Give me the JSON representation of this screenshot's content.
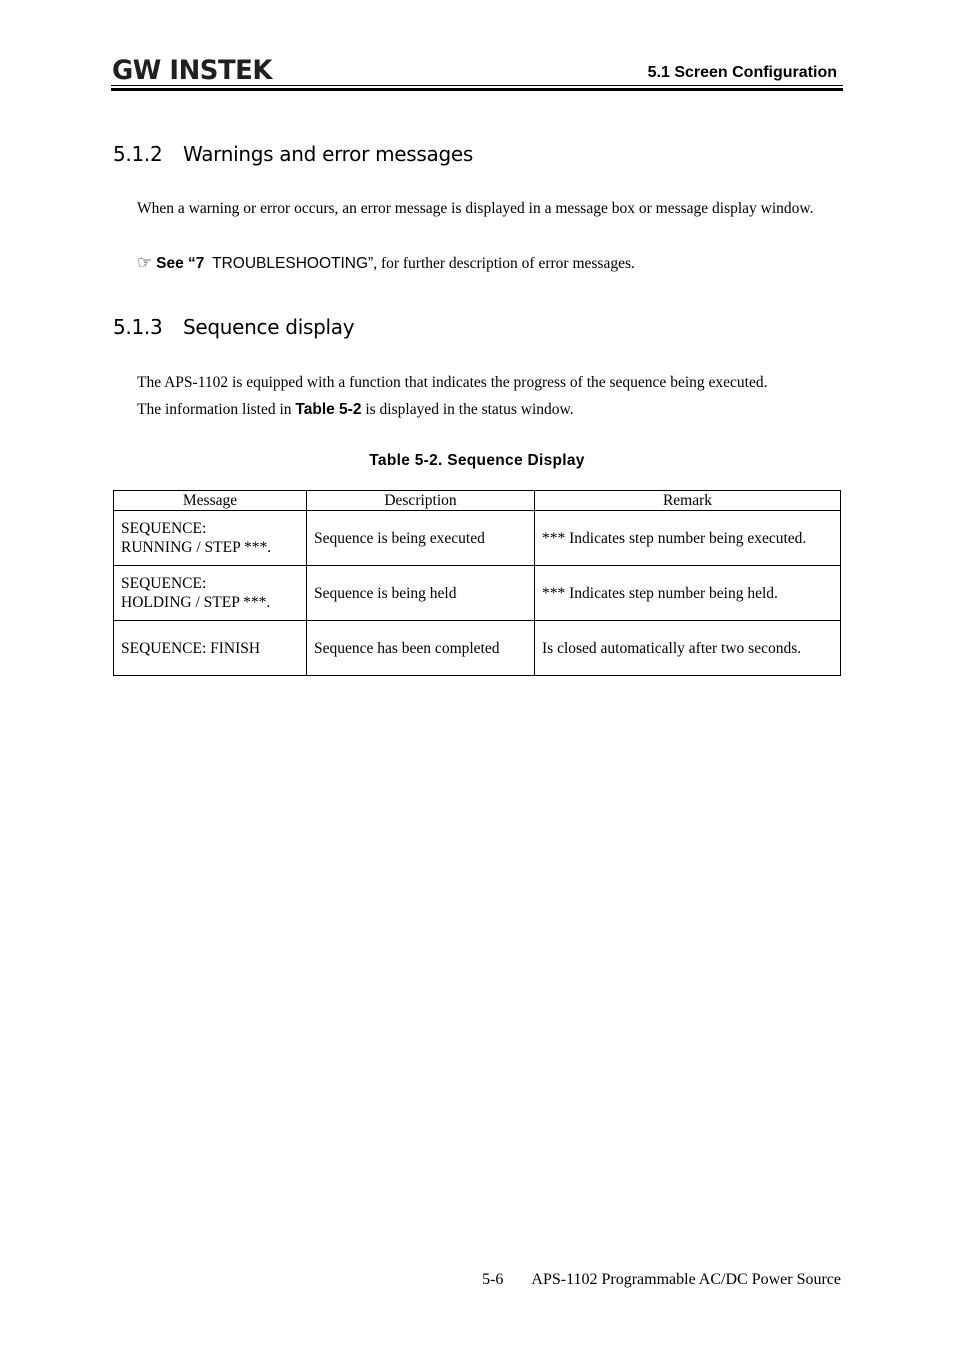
{
  "header": {
    "logo_text": "GW INSTEK",
    "section_title": "5.1 Screen Configuration"
  },
  "section_512": {
    "number": "5.1.2",
    "title": "Warnings and error messages",
    "body": "When a warning or error occurs, an error message is displayed in a message box or message display window.",
    "see_icon": "pointing-hand-icon",
    "see_prefix": "See “7",
    "see_link": "TROUBLESHOOTING”",
    "see_suffix": ", for further description of error messages."
  },
  "section_513": {
    "number": "5.1.3",
    "title": "Sequence display",
    "body_line1": "The APS-1102 is equipped with a function that indicates the progress of the sequence being executed.",
    "body_line2_pre": "The information listed in ",
    "body_line2_ref": "Table 5-2",
    "body_line2_post": " is displayed in the status window."
  },
  "table": {
    "caption": "Table 5-2.  Sequence Display",
    "headers": [
      "Message",
      "Description",
      "Remark"
    ],
    "rows": [
      {
        "message_l1": "SEQUENCE:",
        "message_l2": "RUNNING / STEP ***.",
        "description": "Sequence is being executed",
        "remark": "*** Indicates step number being executed."
      },
      {
        "message_l1": "SEQUENCE:",
        "message_l2": "HOLDING / STEP ***.",
        "description": "Sequence is being held",
        "remark": "*** Indicates step number being held."
      },
      {
        "message_l1": "SEQUENCE: FINISH",
        "message_l2": "",
        "description": "Sequence has been completed",
        "remark": "Is closed automatically after two seconds."
      }
    ]
  },
  "footer": {
    "page_number": "5-6",
    "product": "APS-1102 Programmable AC/DC Power Source"
  }
}
